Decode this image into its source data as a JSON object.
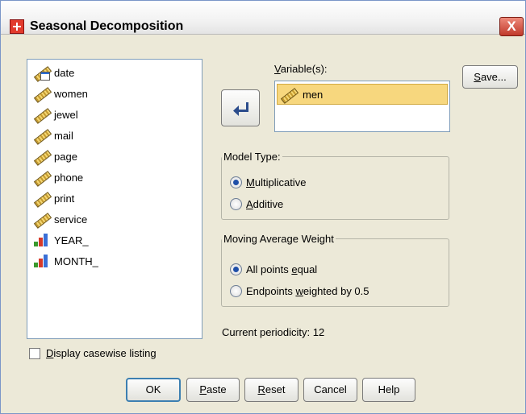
{
  "window": {
    "title": "Seasonal Decomposition",
    "close_glyph": "X"
  },
  "source_list": {
    "items": [
      {
        "label": "date",
        "icon": "date-ruler-icon"
      },
      {
        "label": "women",
        "icon": "scale-ruler-icon"
      },
      {
        "label": "jewel",
        "icon": "scale-ruler-icon"
      },
      {
        "label": "mail",
        "icon": "scale-ruler-icon"
      },
      {
        "label": "page",
        "icon": "scale-ruler-icon"
      },
      {
        "label": "phone",
        "icon": "scale-ruler-icon"
      },
      {
        "label": "print",
        "icon": "scale-ruler-icon"
      },
      {
        "label": "service",
        "icon": "scale-ruler-icon"
      },
      {
        "label": "YEAR_",
        "icon": "ordinal-bars-icon"
      },
      {
        "label": "MONTH_",
        "icon": "ordinal-bars-icon"
      }
    ]
  },
  "variables": {
    "label_mn": "V",
    "label_rest": "ariable(s):",
    "items": [
      {
        "label": "men",
        "icon": "scale-ruler-icon"
      }
    ]
  },
  "save_button": {
    "label_mn": "S",
    "label_rest": "ave..."
  },
  "model_type": {
    "legend": "Model Type:",
    "options": [
      {
        "mn": "M",
        "rest": "ultiplicative",
        "selected": true
      },
      {
        "mn": "A",
        "rest": "dditive",
        "selected": false
      }
    ]
  },
  "moving_avg": {
    "legend": "Moving Average Weight",
    "options": [
      {
        "pre": "All points ",
        "mn": "e",
        "rest": "qual",
        "selected": true
      },
      {
        "pre": "Endpoints ",
        "mn": "w",
        "rest": "eighted by 0.5",
        "selected": false
      }
    ]
  },
  "periodicity": "Current periodicity: 12",
  "casewise": {
    "mn": "D",
    "rest": "isplay casewise listing",
    "checked": false
  },
  "buttons": {
    "ok": "OK",
    "paste_mn": "P",
    "paste_rest": "aste",
    "reset_mn": "R",
    "reset_rest": "eset",
    "cancel": "Cancel",
    "help": "Help"
  }
}
